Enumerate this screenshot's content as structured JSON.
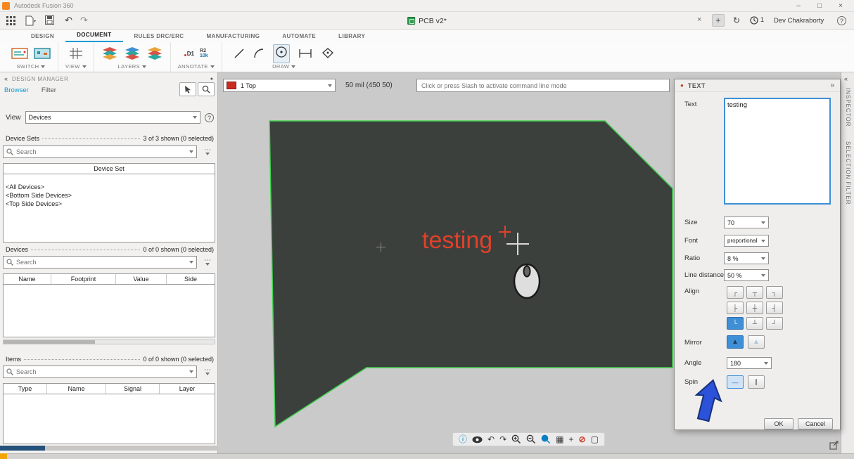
{
  "window": {
    "title": "Autodesk Fusion 360",
    "controls": {
      "minimize": "–",
      "maximize": "□",
      "close": "×"
    }
  },
  "appbar": {
    "doc_tab_label": "PCB v2*",
    "doc_tab_close": "×",
    "new_tab": "+",
    "notification_count": "1",
    "user": "Dev Chakraborty",
    "help": "?"
  },
  "menubar": {
    "tabs": [
      "DESIGN",
      "DOCUMENT",
      "RULES DRC/ERC",
      "MANUFACTURING",
      "AUTOMATE",
      "LIBRARY"
    ],
    "active": "DOCUMENT"
  },
  "ribbon": {
    "groups": {
      "switch": "SWITCH",
      "view": "VIEW",
      "layers": "LAYERS",
      "annotate": "ANNOTATE",
      "draw": "DRAW"
    },
    "annotate_name": "D1",
    "annotate_value_top": "R2",
    "annotate_value_bottom": "10k"
  },
  "design_manager": {
    "title": "DESIGN MANAGER",
    "tabs": {
      "browser": "Browser",
      "filter": "Filter"
    },
    "view_label": "View",
    "view_value": "Devices",
    "device_sets": {
      "label": "Device Sets",
      "count": "3 of 3 shown (0 selected)",
      "search_placeholder": "Search",
      "column": "Device Set",
      "rows": [
        "<All Devices>",
        "<Bottom Side Devices>",
        "<Top Side Devices>"
      ]
    },
    "devices": {
      "label": "Devices",
      "count": "0 of 0 shown (0 selected)",
      "search_placeholder": "Search",
      "columns": [
        "Name",
        "Footprint",
        "Value",
        "Side"
      ]
    },
    "items": {
      "label": "Items",
      "count": "0 of 0 shown (0 selected)",
      "search_placeholder": "Search",
      "columns": [
        "Type",
        "Name",
        "Signal",
        "Layer"
      ]
    }
  },
  "canvas": {
    "layer_value": "1 Top",
    "grid_readout": "50 mil (450 50)",
    "command_placeholder": "Click or press Slash to activate command line mode",
    "board_text": "testing"
  },
  "text_dialog": {
    "title": "TEXT",
    "text_label": "Text",
    "text_value": "testing",
    "size_label": "Size",
    "size_value": "70",
    "font_label": "Font",
    "font_value": "proportional",
    "ratio_label": "Ratio",
    "ratio_value": "8 %",
    "line_distance_label": "Line distance",
    "line_distance_value": "50 %",
    "align_label": "Align",
    "align_icons": [
      "┌",
      "┬",
      "┐",
      "├",
      "┼",
      "┤",
      "└",
      "┴",
      "┘"
    ],
    "mirror_label": "Mirror",
    "angle_label": "Angle",
    "angle_value": "180",
    "spin_label": "Spin",
    "ok": "OK",
    "cancel": "Cancel"
  },
  "right_rail": {
    "inspector": "INSPECTOR",
    "selection_filter": "SELECTION FILTER"
  },
  "icons": {
    "undo": "↶",
    "redo": "↷",
    "sync": "↻",
    "more": "⋯",
    "collapse_left": "«",
    "collapse_right": "»",
    "panel_dot": "●",
    "dialog_dot": "●",
    "info": "ⓘ",
    "grid": "▦",
    "plus": "+",
    "no_entry": "⊘",
    "select_box": "▢",
    "mirror": "▲",
    "spin_h": "—",
    "spin_v": "∥"
  }
}
